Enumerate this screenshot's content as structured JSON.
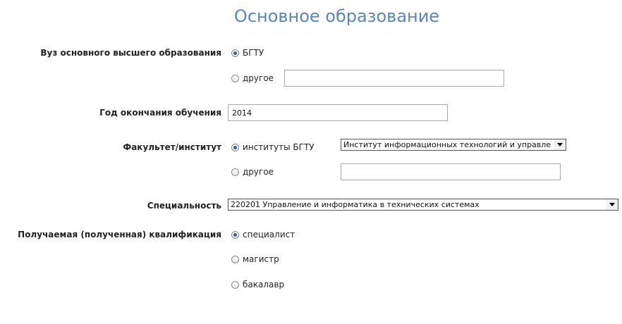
{
  "page": {
    "title": "Основное образование"
  },
  "university": {
    "label": "Вуз основного высшего образования",
    "option_main": "БГТУ",
    "option_other": "другое",
    "other_value": ""
  },
  "graduation": {
    "label": "Год окончания обучения",
    "value": "2014"
  },
  "faculty": {
    "label": "Факультет/институт",
    "option_main": "институты БГТУ",
    "selected": "Институт информационных технологий и управления",
    "option_other": "другое",
    "other_value": ""
  },
  "specialty": {
    "label": "Специальность",
    "selected": "220201 Управление и информатика в технических системах"
  },
  "qualification": {
    "label": "Получаемая (полученная) квалификация",
    "options": [
      "специалист",
      "магистр",
      "бакалавр"
    ],
    "selected": "специалист"
  },
  "colors": {
    "title": "#5b86bd",
    "radio_checked": "#2f5f94"
  }
}
